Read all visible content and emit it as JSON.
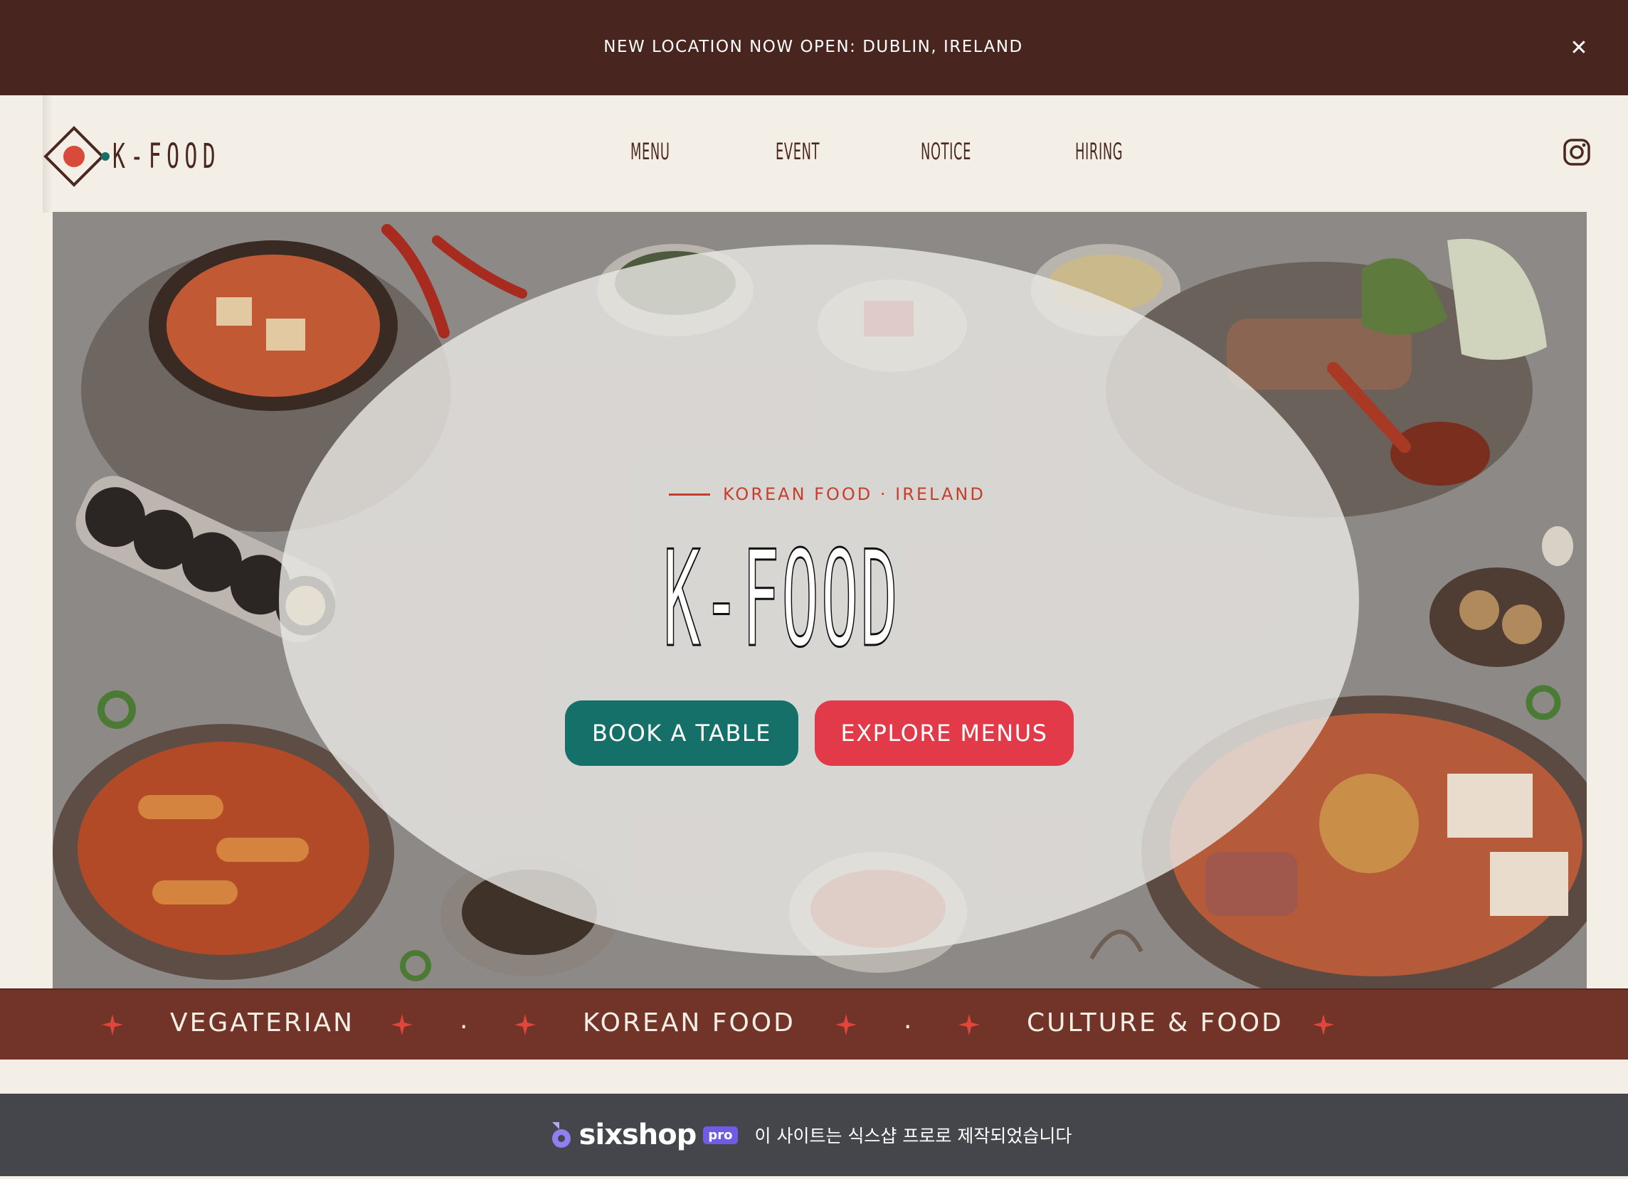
{
  "announcement": {
    "text": "NEW LOCATION NOW OPEN: DUBLIN, IRELAND",
    "close_icon": "close-icon"
  },
  "header": {
    "logo_text": "K-FOOD",
    "nav": [
      {
        "label": "MENU"
      },
      {
        "label": "EVENT"
      },
      {
        "label": "NOTICE"
      },
      {
        "label": "HIRING"
      }
    ],
    "social_icon": "instagram-icon"
  },
  "hero": {
    "eyebrow": "KOREAN FOOD · IRELAND",
    "title": "K-FOOD",
    "book_label": "BOOK A TABLE",
    "explore_label": "EXPLORE MENUS",
    "image": "illustrated-korean-food-spread"
  },
  "marquee": {
    "items": [
      "VEGATERIAN",
      "KOREAN FOOD",
      "CULTURE & FOOD"
    ],
    "separator": "."
  },
  "footer": {
    "brand": "sixshop",
    "badge": "pro",
    "text": "이 사이트는 식스샵 프로로 제작되었습니다"
  },
  "colors": {
    "announcement_bg": "#48261f",
    "page_bg": "#f4efe6",
    "brand_brown": "#4a2820",
    "accent_red": "#c83e2e",
    "book_button": "#16706a",
    "explore_button": "#e23a48",
    "marquee_bg": "#723428",
    "footer_bg": "#45464c"
  }
}
